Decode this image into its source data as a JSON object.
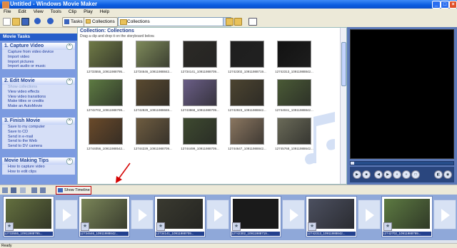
{
  "window": {
    "title": "Untitled - Windows Movie Maker"
  },
  "menu": [
    "File",
    "Edit",
    "View",
    "Tools",
    "Clip",
    "Play",
    "Help"
  ],
  "toolbar": {
    "tasks_label": "Tasks",
    "collections_label": "Collections",
    "collection_value": "Collections"
  },
  "left_panel": {
    "header": "Movie Tasks",
    "sections": [
      {
        "title": "1. Capture Video",
        "items": [
          "Capture from video device",
          "Import video",
          "Import pictures",
          "Import audio or music"
        ]
      },
      {
        "title": "2. Edit Movie",
        "items": [
          "Show collections",
          "View video effects",
          "View video transitions",
          "Make titles or credits",
          "Make an AutoMovie"
        ]
      },
      {
        "title": "3. Finish Movie",
        "items": [
          "Save to my computer",
          "Save to CD",
          "Send in e-mail",
          "Send to the Web",
          "Send to DV camera"
        ]
      },
      {
        "title": "Movie Making Tips",
        "items": [
          "How to capture video",
          "How to edit clips"
        ]
      }
    ]
  },
  "collection": {
    "title": "Collection: Collections",
    "subtitle": "Drag a clip and drop it on the storyboard below.",
    "thumbs": [
      {
        "label": "12733555_10911988795...",
        "color": "#6f7a46"
      },
      {
        "label": "12734646_10911988842...",
        "color": "#7e8a5a"
      },
      {
        "label": "12734141_10911988709...",
        "color": "#2c2a26"
      },
      {
        "label": "12742302_10911988719...",
        "color": "#1e1e1e"
      },
      {
        "label": "12742313_10911988842...",
        "color": "#121212"
      },
      {
        "label": "12742702_10911988799...",
        "color": "#5d7a42"
      },
      {
        "label": "12742829_10911988669...",
        "color": "#5a4a30"
      },
      {
        "label": "12743868_10911988709...",
        "color": "#6a5e86"
      },
      {
        "label": "12742923_10911988842...",
        "color": "#4c4430"
      },
      {
        "label": "12744041_10911988842...",
        "color": "#4a5a36"
      },
      {
        "label": "12744056_10911988542...",
        "color": "#6a4a2a"
      },
      {
        "label": "12744229_10911988709...",
        "color": "#6e5c40"
      },
      {
        "label": "12744499_10911988709...",
        "color": "#3e4a30"
      },
      {
        "label": "12744647_10911988842...",
        "color": "#8a7660"
      },
      {
        "label": "12745768_10911988642...",
        "color": "#6a6a58"
      }
    ]
  },
  "storyboard": {
    "show_timeline_label": "Show Timeline",
    "clips": [
      {
        "caption": "12733555_10911988795...",
        "color": "#64703f"
      },
      {
        "caption": "12734646_10911988842...",
        "color": "#7a8558"
      },
      {
        "caption": "12734141_10911988709...",
        "color": "#3a3a30"
      },
      {
        "caption": "12742302_10911988719...",
        "color": "#1a1a1a"
      },
      {
        "caption": "12742313_10911988842...",
        "color": "#4c5060"
      },
      {
        "caption": "12742702_10911988799...",
        "color": "#5d7a42"
      }
    ]
  },
  "status": "Ready"
}
